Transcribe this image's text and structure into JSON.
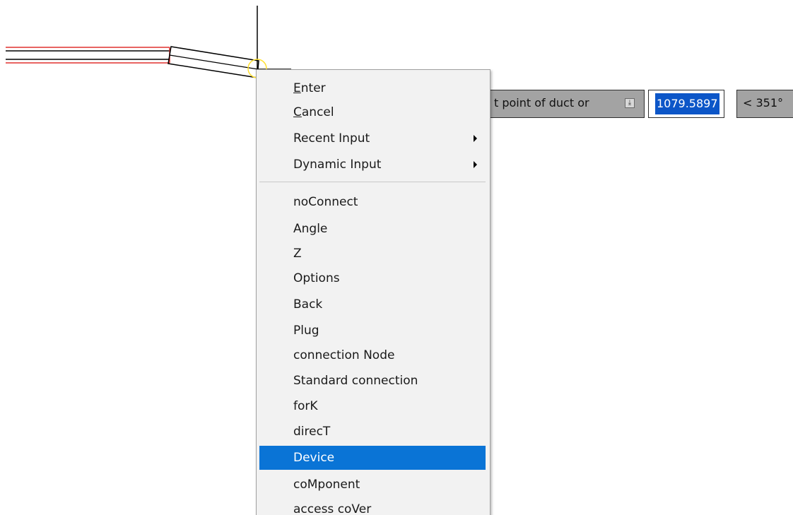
{
  "dynamic_input": {
    "prompt_text": "t point of duct or",
    "dropdown_icon": "down-arrow-box-icon",
    "value": "1079.5897",
    "angle": "< 351°"
  },
  "context_menu": {
    "items": [
      {
        "label": "Enter",
        "underline_char": "E",
        "has_submenu": false
      },
      {
        "label": "Cancel",
        "underline_char": "C",
        "has_submenu": false
      },
      {
        "label": "Recent Input",
        "has_submenu": true
      },
      {
        "label": "Dynamic Input",
        "has_submenu": true
      },
      {
        "label": "noConnect"
      },
      {
        "label": "Angle"
      },
      {
        "label": "Z"
      },
      {
        "label": "Options"
      },
      {
        "label": "Back"
      },
      {
        "label": "Plug"
      },
      {
        "label": "connection Node"
      },
      {
        "label": "Standard connection"
      },
      {
        "label": "forK"
      },
      {
        "label": "direcT"
      },
      {
        "label": "Device",
        "highlighted": true
      },
      {
        "label": "coMponent"
      },
      {
        "label": "access coVer"
      }
    ]
  },
  "colors": {
    "menu_highlight": "#0a74d6",
    "duct_red": "#e0302f",
    "snap_marker": "#ffe030",
    "selection_blue": "#0c56c8"
  }
}
